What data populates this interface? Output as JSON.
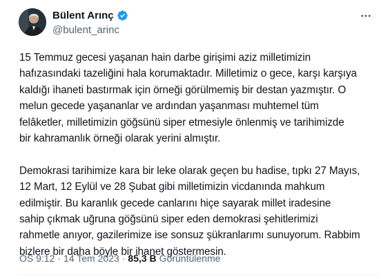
{
  "author": {
    "name": "Bülent Arınç",
    "handle": "@bulent_arinc",
    "verified": true,
    "verified_color": "#1d9bf0"
  },
  "tweet": {
    "paragraph1": "15 Temmuz gecesi yaşanan hain darbe girişimi aziz milletimizin\nhafızasındaki tazeliğini hala korumaktadır. Milletimiz o gece, karşı karşıya\nkaldığı ihaneti bastırmak için örneği görülmemiş bir destan yazmıştır. O\nmelun gecede yaşananlar ve ardından yaşanması muhtemel tüm\nfelâketler, milletimizin göğsünü siper etmesiyle önlenmiş ve tarihimizde\nbir kahramanlık örneği olarak yerini almıştır.",
    "paragraph2": "Demokrasi tarihimize kara bir leke olarak geçen bu hadise, tıpkı 27 Mayıs,\n12 Mart, 12 Eylül ve 28 Şubat gibi milletimizin vicdanında mahkum\nedilmiştir. Bu karanlık gecede canlarını hiçe sayarak millet iradesine\nsahip çıkmak uğruna göğsünü siper eden demokrasi şehitlerimizi\nrahmetle anıyor, gazilerimize ise sonsuz şükranlarımı sunuyorum. Rabbim\nbizlere bir daha böyle bir ihanet göstermesin."
  },
  "meta": {
    "time": "ÖS 9:12",
    "separator": "·",
    "date": "14 Tem 2023",
    "views_count": "85,3 B",
    "views_label": "Görüntülenme"
  },
  "icons": {
    "more": "more-horizontal-icon",
    "verified": "verified-badge-icon"
  }
}
